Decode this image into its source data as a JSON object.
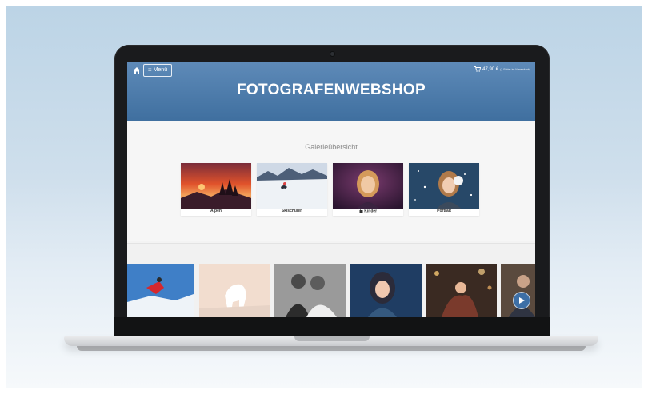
{
  "site": {
    "title": "FOTOGRAFENWEBSHOP",
    "menu_label": "Menü",
    "cart_total": "47,90 €",
    "cart_detail": "(1 Bilder im Warenkorb)"
  },
  "overview": {
    "heading": "Galerieübersicht",
    "galleries": [
      {
        "label": "Alpen",
        "locked": false
      },
      {
        "label": "Skischulen",
        "locked": false
      },
      {
        "label": "Kinder",
        "locked": true
      },
      {
        "label": "Portrait",
        "locked": false
      }
    ]
  },
  "icons": {
    "home": "home-icon",
    "menu": "hamburger-icon",
    "cart": "cart-icon",
    "lock": "lock-icon",
    "next": "next-arrow-icon"
  },
  "colors": {
    "header_top": "#5e8ab8",
    "header_bottom": "#3f6f9f",
    "accent": "#3d6fa6"
  }
}
